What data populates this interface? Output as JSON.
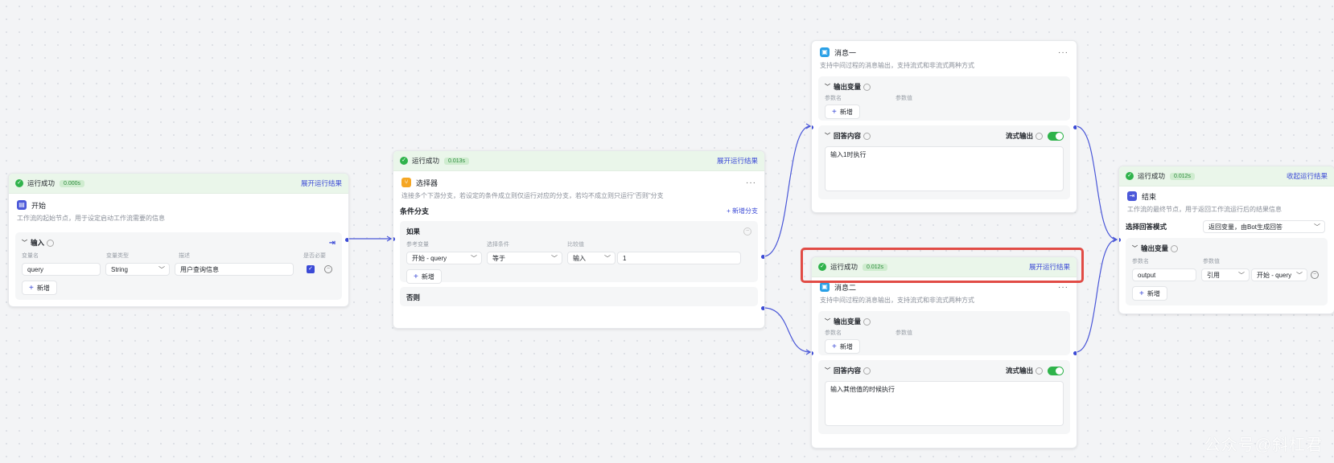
{
  "status": {
    "success": "运行成功",
    "expand": "展开运行结果",
    "collapse": "收起运行结果"
  },
  "start": {
    "time": "0.000s",
    "title": "开始",
    "desc": "工作流的起始节点，用于设定启动工作流需要的信息",
    "input_section": "输入",
    "cols": [
      "变量名",
      "变量类型",
      "描述",
      "是否必要"
    ],
    "var_name": "query",
    "var_type": "String",
    "var_desc": "用户查询信息",
    "add": "新增"
  },
  "selector": {
    "time": "0.013s",
    "title": "选择器",
    "desc": "连接多个下游分支，若设定的条件成立则仅运行对应的分支，若均不成立则只运行\"否则\"分支",
    "branch_title": "条件分支",
    "add_branch": "新增分支",
    "if_label": "如果",
    "cols": [
      "参考变量",
      "选择条件",
      "比较值"
    ],
    "ref": "开始 - query",
    "cond": "等于",
    "mode": "输入",
    "value": "1",
    "add": "新增",
    "else_label": "否则"
  },
  "msg1": {
    "title": "消息一",
    "desc": "支持中间过程的消息输出，支持流式和非流式两种方式",
    "output_vars": "输出变量",
    "cols": [
      "参数名",
      "参数值"
    ],
    "add": "新增",
    "answer": "回答内容",
    "stream": "流式输出",
    "content": "输入1时执行"
  },
  "msg2": {
    "time": "0.012s",
    "title": "消息二",
    "desc": "支持中间过程的消息输出，支持流式和非流式两种方式",
    "output_vars": "输出变量",
    "cols": [
      "参数名",
      "参数值"
    ],
    "add": "新增",
    "answer": "回答内容",
    "stream": "流式输出",
    "content": "输入其他值的时候执行"
  },
  "end": {
    "time": "0.012s",
    "title": "结束",
    "desc": "工作流的最终节点，用于返回工作流运行后的结果信息",
    "mode_label": "选择回答模式",
    "mode_value": "返回变量，由Bot生成回答",
    "output_vars": "输出变量",
    "cols": [
      "参数名",
      "参数值"
    ],
    "param_name": "output",
    "ref_type": "引用",
    "ref_value": "开始 - query",
    "add": "新增"
  },
  "watermark": "公众号@斜杠君",
  "colors": {
    "accent": "#3b4ad6",
    "success": "#2fb34b",
    "highlight": "#e14b45"
  }
}
